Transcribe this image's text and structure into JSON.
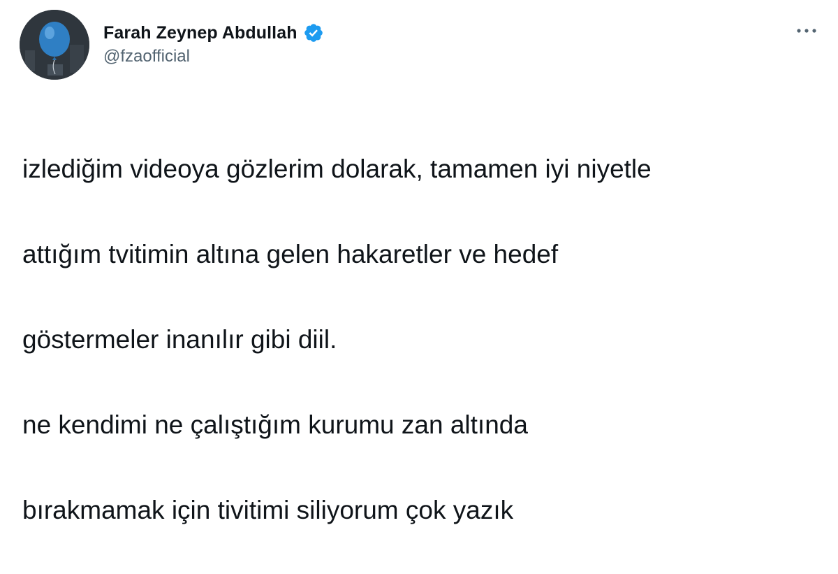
{
  "author": {
    "display_name": "Farah Zeynep Abdullah",
    "handle": "@fzaofficial",
    "verified": true
  },
  "icons": {
    "verified": "verified-badge-icon",
    "more": "more-horizontal-icon",
    "avatar": "balloon-profile-photo"
  },
  "colors": {
    "verified_badge": "#1d9bf0",
    "secondary_text": "#536471",
    "primary_text": "#0f1419"
  },
  "tweet": {
    "lines": [
      "izlediğim videoya gözlerim dolarak, tamamen iyi niyetle",
      "attığım tvitimin altına gelen hakaretler ve hedef",
      "göstermeler inanılır gibi diil.",
      "ne kendimi ne çalıştığım kurumu zan altında",
      "bırakmamak için tivitimi siliyorum çok yazık"
    ]
  }
}
